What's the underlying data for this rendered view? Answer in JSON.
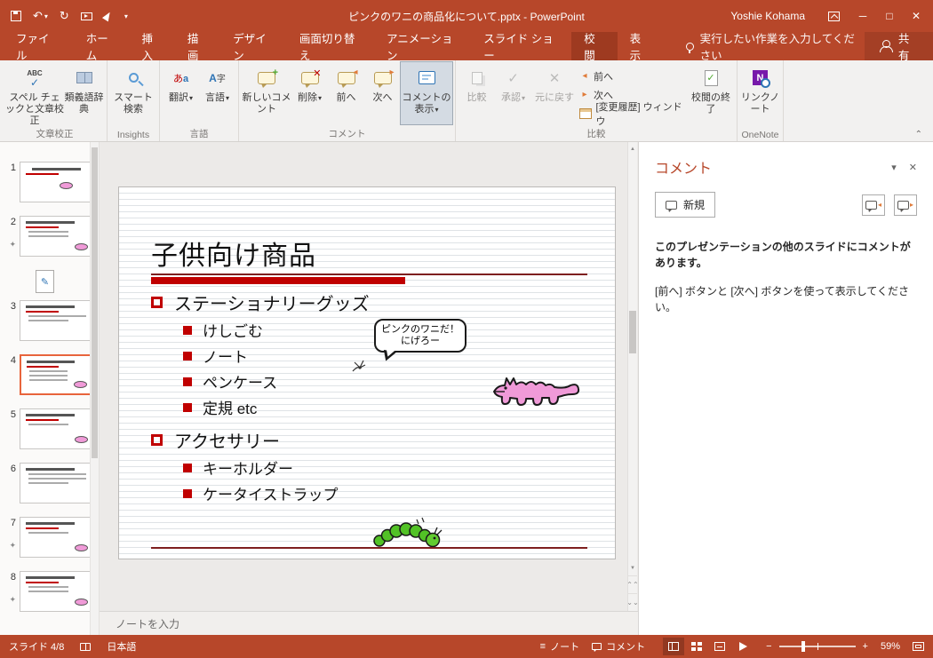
{
  "titlebar": {
    "title": "ピンクのワニの商品化について.pptx - PowerPoint",
    "user": "Yoshie Kohama"
  },
  "tabs": {
    "file": "ファイル",
    "items": [
      "ホーム",
      "挿入",
      "描画",
      "デザイン",
      "画面切り替え",
      "アニメーション",
      "スライド ショー",
      "校閲",
      "表示"
    ],
    "tellme": "実行したい作業を入力してください",
    "share": "共有"
  },
  "ribbon": {
    "groups": [
      {
        "label": "文章校正",
        "buttons": [
          {
            "label": "スペル チェックと文章校正"
          },
          {
            "label": "類義語辞典"
          }
        ]
      },
      {
        "label": "Insights",
        "buttons": [
          {
            "label": "スマート検索"
          }
        ]
      },
      {
        "label": "言語",
        "buttons": [
          {
            "label": "翻訳"
          },
          {
            "label": "言語"
          }
        ]
      },
      {
        "label": "コメント",
        "buttons": [
          {
            "label": "新しいコメント"
          },
          {
            "label": "削除"
          },
          {
            "label": "前へ"
          },
          {
            "label": "次へ"
          },
          {
            "label": "コメントの表示"
          }
        ]
      },
      {
        "label": "比較",
        "buttons": [
          {
            "label": "比較"
          },
          {
            "label": "承認"
          },
          {
            "label": "元に戻す"
          },
          {
            "label": "校閲の終了"
          }
        ],
        "small_buttons": [
          {
            "label": "前へ"
          },
          {
            "label": "次へ"
          },
          {
            "label": "[変更履歴] ウィンドウ"
          }
        ]
      },
      {
        "label": "OneNote",
        "buttons": [
          {
            "label": "リンクノート"
          }
        ]
      }
    ]
  },
  "thumbnails": {
    "items": [
      {
        "n": "1"
      },
      {
        "n": "2",
        "star": true
      },
      {
        "n": "3"
      },
      {
        "n": "4",
        "selected": true
      },
      {
        "n": "5"
      },
      {
        "n": "6"
      },
      {
        "n": "7",
        "star": true
      },
      {
        "n": "8",
        "star": true
      }
    ]
  },
  "slide": {
    "title": "子供向け商品",
    "bullets": [
      {
        "level": 1,
        "text": "ステーショナリーグッズ"
      },
      {
        "level": 2,
        "text": "けしごむ"
      },
      {
        "level": 2,
        "text": "ノート"
      },
      {
        "level": 2,
        "text": "ペンケース"
      },
      {
        "level": 2,
        "text": "定規 etc"
      },
      {
        "level": 1,
        "text": "アクセサリー"
      },
      {
        "level": 2,
        "text": "キーホルダー"
      },
      {
        "level": 2,
        "text": "ケータイストラップ"
      }
    ],
    "callout": {
      "line1": "ピンクのワニだ！",
      "line2": "にげろー"
    }
  },
  "comments": {
    "title": "コメント",
    "new_label": "新規",
    "message_bold": "このプレゼンテーションの他のスライドにコメントがあります。",
    "message_hint": "[前へ] ボタンと [次へ] ボタンを使って表示してください。"
  },
  "notes": {
    "placeholder": "ノートを入力"
  },
  "status": {
    "slide_indicator": "スライド 4/8",
    "language": "日本語",
    "notes_label": "ノート",
    "comments_label": "コメント",
    "zoom": "59%"
  },
  "icons": {
    "undo": "↶",
    "redo": "↻",
    "dropdown_caret": "▾",
    "minimize": "─",
    "maximize": "□",
    "close": "✕",
    "pane_caret": "▾",
    "pane_close": "✕",
    "ribbon_collapse": "⌃",
    "star": "✦",
    "zoom_minus": "−",
    "zoom_plus": "+",
    "notes_lines": "≡",
    "prev_arrow": "◂",
    "next_arrow": "▸",
    "pencil": "✎",
    "check": "✓",
    "cross": "✕",
    "plus": "+",
    "abc": "ABC",
    "translate_a": "あ",
    "translate_b": "a",
    "language_a": "A",
    "language_b": "字",
    "onenote_n": "N",
    "scroll_up": "▲",
    "scroll_down": "▼",
    "prev_slide": "⌃⌃",
    "next_slide": "⌄⌄"
  }
}
